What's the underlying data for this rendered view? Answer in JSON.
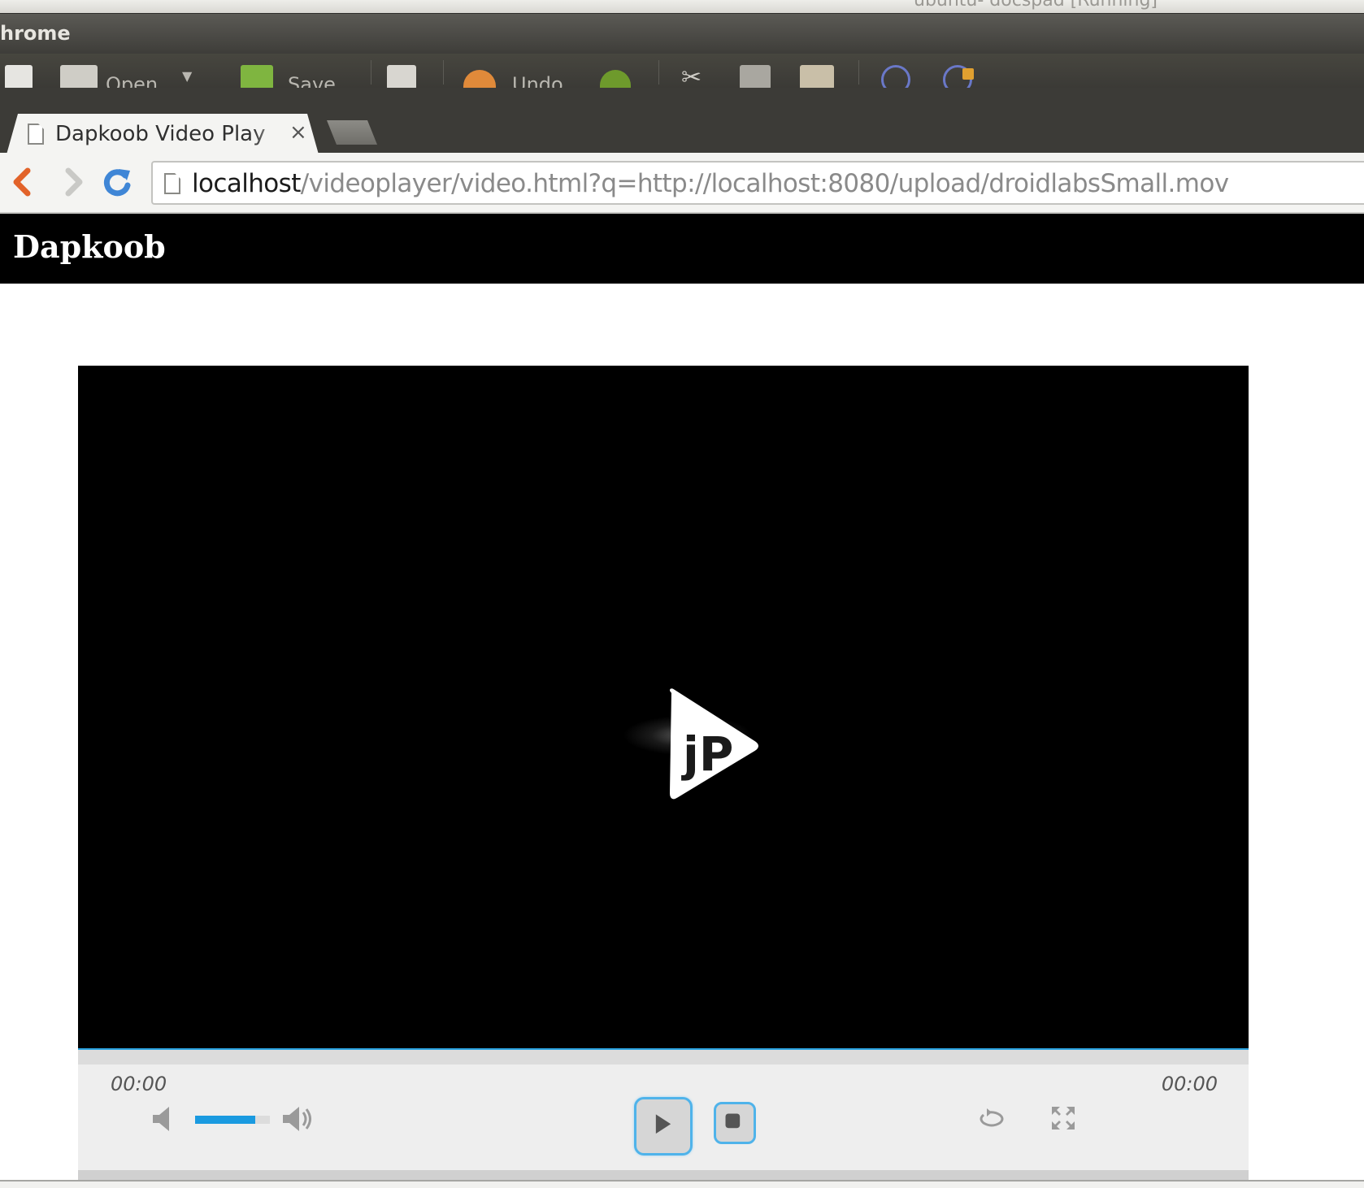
{
  "os": {
    "vm_title": "ubuntu- docspad [Running]"
  },
  "vm_window": {
    "title": "hrome"
  },
  "toolbar": {
    "open_label": "Open",
    "save_label": "Save",
    "undo_label": "Undo"
  },
  "browser": {
    "tab_title": "Dapkoob Video Play",
    "tab_close": "×",
    "url_host": "localhost",
    "url_path": "/videoplayer/video.html?q=http://localhost:8080/upload/droidlabsSmall.mov"
  },
  "page": {
    "site_title": "Dapkoob"
  },
  "player": {
    "logo_text": "jP",
    "current_time": "00:00",
    "duration": "00:00",
    "volume_level": 0.8,
    "progress_level": 0,
    "colors": {
      "accent": "#1a9ae0",
      "controls_bg": "#eeeeee",
      "video_bg": "#000000"
    }
  },
  "icons": {
    "back": "chevron-left-icon",
    "forward": "chevron-right-icon",
    "reload": "reload-icon",
    "mute": "mute-icon",
    "volume_max": "volume-max-icon",
    "play": "play-icon",
    "stop": "stop-icon",
    "repeat": "repeat-icon",
    "fullscreen": "fullscreen-icon"
  }
}
